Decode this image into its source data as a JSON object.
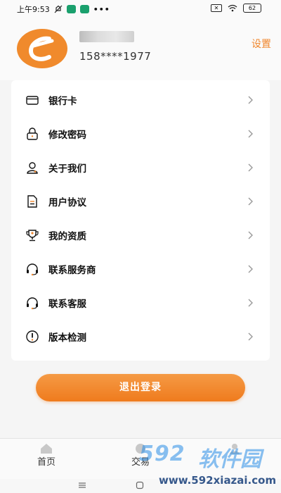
{
  "status_bar": {
    "time": "上午9:53",
    "dots": "•••",
    "battery": "62"
  },
  "profile": {
    "phone": "158****1977",
    "settings_label": "设置"
  },
  "menu": {
    "items": [
      {
        "label": "银行卡",
        "icon": "bank-card-icon"
      },
      {
        "label": "修改密码",
        "icon": "lock-icon"
      },
      {
        "label": "关于我们",
        "icon": "user-icon"
      },
      {
        "label": "用户协议",
        "icon": "document-icon"
      },
      {
        "label": "我的资质",
        "icon": "trophy-icon"
      },
      {
        "label": "联系服务商",
        "icon": "headset-icon"
      },
      {
        "label": "联系客服",
        "icon": "headset-icon"
      },
      {
        "label": "版本检测",
        "icon": "alert-icon"
      }
    ]
  },
  "logout_label": "退出登录",
  "tabs": [
    {
      "label": "首页",
      "icon": "home-icon"
    },
    {
      "label": "交易",
      "icon": "trade-icon"
    },
    {
      "label": "",
      "icon": "profile-icon"
    }
  ],
  "watermark": {
    "number": "592",
    "brand": "软件园",
    "url": "www.592xiazai.com"
  },
  "colors": {
    "accent": "#ef7b1d",
    "settings_text": "#f0862c",
    "icon": "#111111"
  }
}
